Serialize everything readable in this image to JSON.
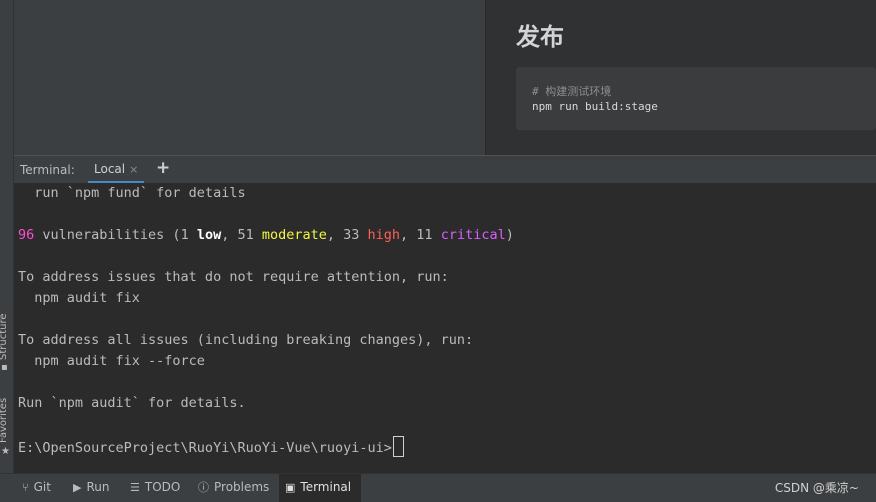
{
  "side_tabs": {
    "structure": "Structure",
    "favorites": "Favorites"
  },
  "preview": {
    "heading": "发布",
    "code_comment": "# 构建测试环境",
    "code_line": "npm run build:stage"
  },
  "terminal": {
    "title": "Terminal:",
    "tab_label": "Local",
    "close_glyph": "×",
    "add_glyph": "+",
    "lines": {
      "fund": "  run `npm fund` for details",
      "vuln_count": "96",
      "vuln_a": " vulnerabilities (1 ",
      "low": "low",
      "vuln_b": ", 51 ",
      "moderate": "moderate",
      "vuln_c": ", 33 ",
      "high": "high",
      "vuln_d": ", 11 ",
      "critical": "critical",
      "vuln_e": ")",
      "address1": "To address issues that do not require attention, run:",
      "fix1": "  npm audit fix",
      "address2": "To address all issues (including breaking changes), run:",
      "fix2": "  npm audit fix --force",
      "details": "Run `npm audit` for details.",
      "prompt": "E:\\OpenSourceProject\\RuoYi\\RuoYi-Vue\\ruoyi-ui>"
    }
  },
  "statusbar": {
    "items": [
      {
        "label": "Git",
        "icon": "branch-icon"
      },
      {
        "label": "Run",
        "icon": "play-icon"
      },
      {
        "label": "TODO",
        "icon": "list-icon"
      },
      {
        "label": "Problems",
        "icon": "info-icon"
      },
      {
        "label": "Terminal",
        "icon": "terminal-icon"
      }
    ],
    "watermark": "CSDN @乘凉~"
  },
  "colors": {
    "accent": "#4a88c7",
    "magenta": "#ff4fd0",
    "yellow": "#f5f543",
    "red": "#ff5f58",
    "violet": "#d85eff"
  }
}
